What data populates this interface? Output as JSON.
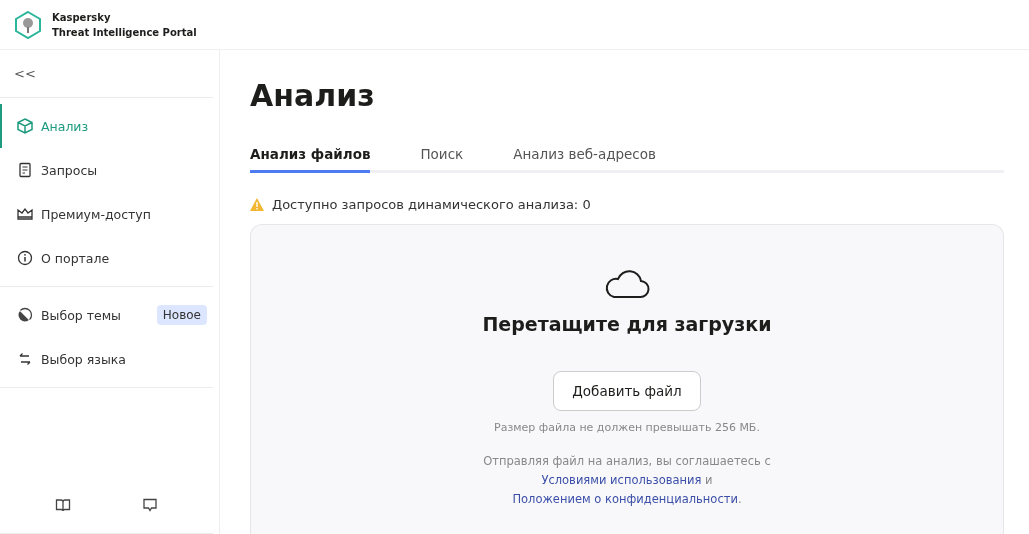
{
  "brand": {
    "line_1": "Kaspersky",
    "line_2": "Threat Intelligence Portal"
  },
  "sidebar": {
    "collapse": "<<",
    "nav": [
      {
        "label": "Анализ",
        "selected": true
      },
      {
        "label": "Запросы",
        "selected": false
      },
      {
        "label": "Премиум-доступ",
        "selected": false
      },
      {
        "label": "О портале",
        "selected": false
      }
    ],
    "settings": [
      {
        "label": "Выбор темы",
        "badge": "Новое"
      },
      {
        "label": "Выбор языка"
      }
    ]
  },
  "page_title": "Анализ",
  "tabs": [
    {
      "label": "Анализ файлов",
      "selected": true
    },
    {
      "label": "Поиск",
      "selected": false
    },
    {
      "label": "Анализ веб-адресов",
      "selected": false
    }
  ],
  "notice": "Доступно запросов динамического анализа: 0",
  "dropzone": {
    "title": "Перетащите для загрузки",
    "button": "Добавить файл",
    "size_note": "Размер файла не должен превышать 256 МБ.",
    "consent": [
      {
        "kind": "text",
        "text": "Отправляя файл на анализ, вы соглашаетесь с "
      },
      {
        "kind": "link",
        "text": "Условиями использования"
      },
      {
        "kind": "text",
        "text": " и "
      },
      {
        "kind": "link",
        "text": "Положением о конфиденциальности"
      },
      {
        "kind": "text",
        "text": "."
      }
    ]
  }
}
